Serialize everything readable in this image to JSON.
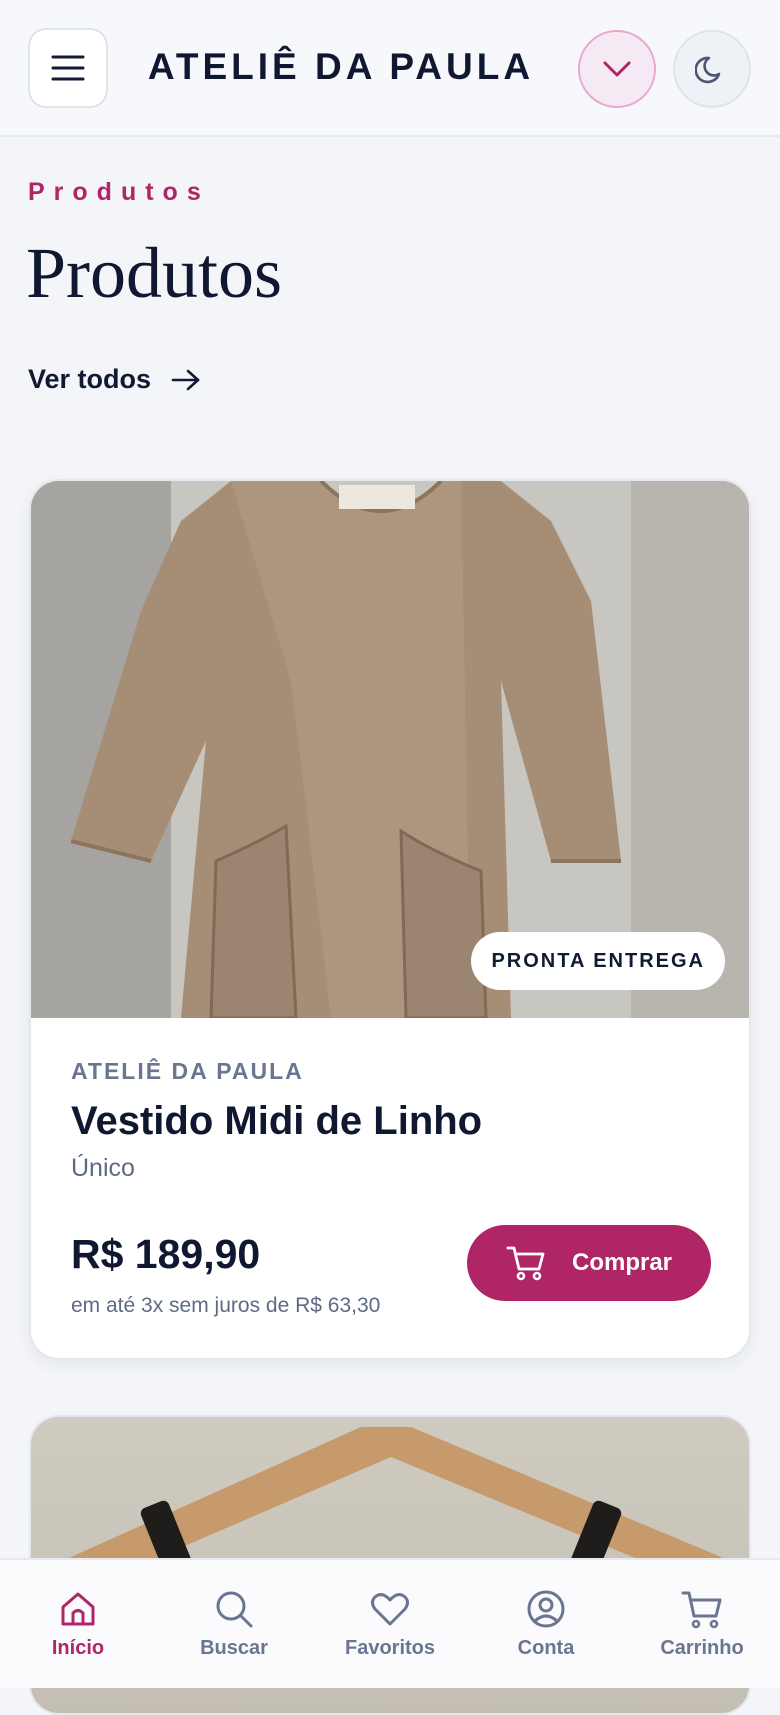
{
  "header": {
    "brand": "ATELIÊ DA PAULA"
  },
  "section": {
    "eyebrow": "Produtos",
    "title": "Produtos",
    "see_all": "Ver todos"
  },
  "products": [
    {
      "badge": "PRONTA ENTREGA",
      "seller": "ATELIÊ DA PAULA",
      "name": "Vestido Midi de Linho",
      "variant": "Único",
      "price": "R$ 189,90",
      "installments": "em até 3x sem juros de R$ 63,30",
      "buy_label": "Comprar"
    }
  ],
  "nav": [
    {
      "label": "Início",
      "icon": "home-icon",
      "active": true
    },
    {
      "label": "Buscar",
      "icon": "search-icon",
      "active": false
    },
    {
      "label": "Favoritos",
      "icon": "heart-icon",
      "active": false
    },
    {
      "label": "Conta",
      "icon": "account-icon",
      "active": false
    },
    {
      "label": "Carrinho",
      "icon": "cart-icon",
      "active": false
    }
  ],
  "colors": {
    "accent": "#b02566",
    "text_dark": "#0f1830",
    "text_muted": "#6a7591",
    "background": "#f3f5f9"
  }
}
